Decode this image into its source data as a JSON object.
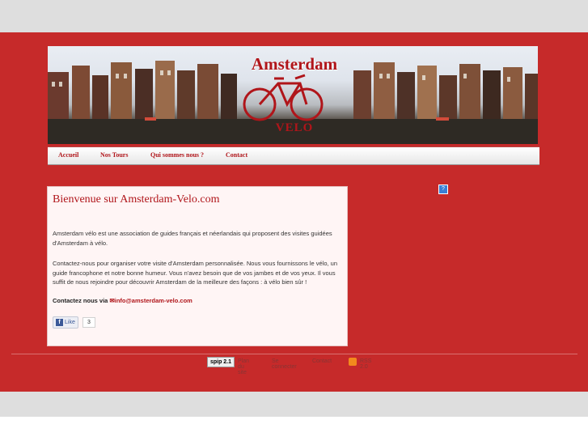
{
  "banner": {
    "title": "Amsterdam",
    "subtitle": "VELO"
  },
  "nav": {
    "items": [
      "Accueil",
      "Nos Tours",
      "Qui sommes nous ?",
      "Contact"
    ]
  },
  "content": {
    "title": "Bienvenue sur Amsterdam-Velo.com",
    "para1": "Amsterdam vélo est une association de guides français et néerlandais qui proposent des visites guidées d'Amsterdam à vélo.",
    "para2": "Contactez-nous pour organiser votre visite d'Amsterdam personnalisée. Nous vous fournissons le vélo, un guide francophone et notre bonne humeur. Vous n'avez besoin que de vos jambes et de vos yeux. Il vous suffit de nous rejoindre pour découvrir Amsterdam de la meilleure des façons : à vélo bien sûr !",
    "contact_prefix": "Contactez nous via",
    "contact_email": "info@amsterdam-velo.com",
    "like_label": "Like",
    "like_count": "3"
  },
  "footer": {
    "badge": "spip 2.1",
    "links": [
      "Plan du site",
      "Se connecter",
      "Contact",
      "RSS 2.0"
    ]
  },
  "colors": {
    "accent": "#c62a2a",
    "link": "#b0151a"
  }
}
